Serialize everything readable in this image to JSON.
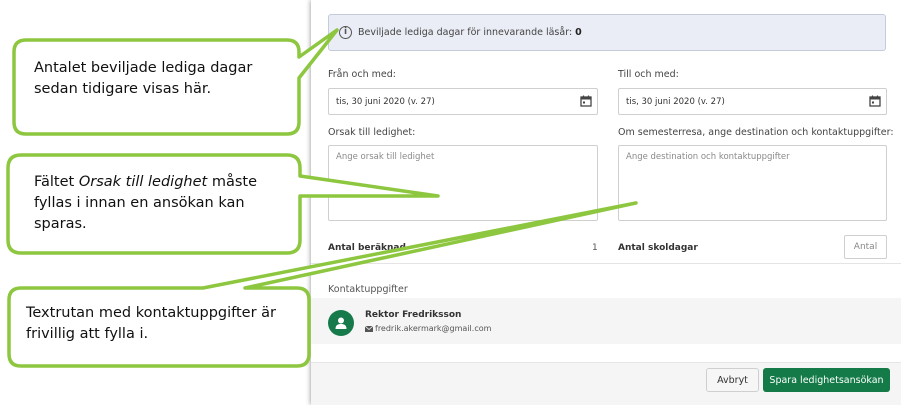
{
  "dialog": {
    "info": {
      "text": "Beviljade lediga dagar för innevarande läsår:",
      "value": "0"
    },
    "from": {
      "label": "Från och med:",
      "value": "tis, 30 juni 2020 (v. 27)"
    },
    "to": {
      "label": "Till och med:",
      "value": "tis, 30 juni 2020 (v. 27)"
    },
    "reason": {
      "label": "Orsak till ledighet:",
      "placeholder": "Ange orsak till ledighet"
    },
    "destination": {
      "label": "Om semesterresa, ange destination och kontaktuppgifter:",
      "placeholder": "Ange destination och kontaktuppgifter"
    },
    "calculated": {
      "label": "Antal beräknad",
      "value": "1"
    },
    "school_days": {
      "label": "Antal skoldagar",
      "placeholder": "Antal"
    },
    "contacts": {
      "title": "Kontaktuppgifter",
      "name": "Rektor Fredriksson",
      "email": "fredrik.akermark@gmail.com"
    },
    "footer": {
      "cancel_label": "Avbryt",
      "save_label": "Spara ledighetsansökan"
    }
  },
  "callouts": [
    {
      "text": "Antalet beviljade lediga dagar sedan tidigare visas här."
    },
    {
      "pre": "Fältet ",
      "italic": "Orsak till ledighet",
      "post": " måste fyllas i innan en ansökan kan sparas."
    },
    {
      "text": "Textrutan med kontaktuppgifter är frivillig att fylla i."
    }
  ],
  "colors": {
    "callout_border": "#8dc63f",
    "primary_green": "#137a48",
    "info_bg": "#eaedf5"
  }
}
